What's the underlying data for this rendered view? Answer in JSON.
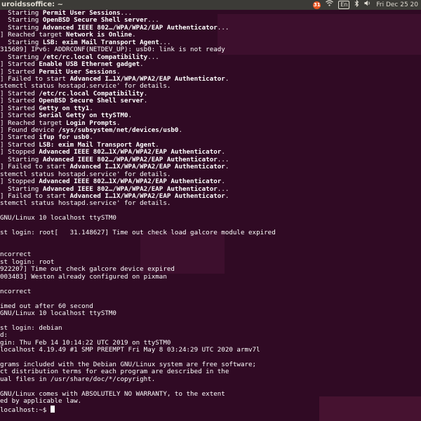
{
  "topbar": {
    "title": "uroidssoffice: ~",
    "clock": "Fri Dec 25 20",
    "lang": "En",
    "badge": "31",
    "icons": [
      "chrome-icon",
      "wifi-icon",
      "keyboard-language-icon",
      "bluetooth-icon",
      "volume-icon"
    ]
  },
  "terminal": {
    "lines": [
      [
        {
          "t": "  Starting "
        },
        {
          "t": "Permit User Sessions",
          "b": true
        },
        {
          "t": "..."
        }
      ],
      [
        {
          "t": "  Starting "
        },
        {
          "t": "OpenBSD Secure Shell server",
          "b": true
        },
        {
          "t": "..."
        }
      ],
      [
        {
          "t": "  Starting "
        },
        {
          "t": "Advanced IEEE 802…/WPA/WPA2/EAP Authenticator",
          "b": true
        },
        {
          "t": "..."
        }
      ],
      [
        {
          "t": "] Reached target "
        },
        {
          "t": "Network is Online",
          "b": true
        },
        {
          "t": "."
        }
      ],
      [
        {
          "t": "  Starting "
        },
        {
          "t": "LSB: exim Mail Transport Agent",
          "b": true
        },
        {
          "t": "..."
        }
      ],
      [
        {
          "t": "315689] IPv6: ADDRCONF(NETDEV_UP): usb0: link is not ready"
        }
      ],
      [
        {
          "t": "  Starting "
        },
        {
          "t": "/etc/rc.local Compatibility",
          "b": true
        },
        {
          "t": "..."
        }
      ],
      [
        {
          "t": "] Started "
        },
        {
          "t": "Enable USB Ethernet gadget",
          "b": true
        },
        {
          "t": "."
        }
      ],
      [
        {
          "t": "] Started "
        },
        {
          "t": "Permit User Sessions",
          "b": true
        },
        {
          "t": "."
        }
      ],
      [
        {
          "t": "] Failed to start "
        },
        {
          "t": "Advanced I…1X/WPA/WPA2/EAP Authenticator",
          "b": true
        },
        {
          "t": "."
        }
      ],
      [
        {
          "t": "stemctl status hostapd.service' for details."
        }
      ],
      [
        {
          "t": "] Started "
        },
        {
          "t": "/etc/rc.local Compatibility",
          "b": true
        },
        {
          "t": "."
        }
      ],
      [
        {
          "t": "] Started "
        },
        {
          "t": "OpenBSD Secure Shell server",
          "b": true
        },
        {
          "t": "."
        }
      ],
      [
        {
          "t": "] Started "
        },
        {
          "t": "Getty on tty1",
          "b": true
        },
        {
          "t": "."
        }
      ],
      [
        {
          "t": "] Started "
        },
        {
          "t": "Serial Getty on ttySTM0",
          "b": true
        },
        {
          "t": "."
        }
      ],
      [
        {
          "t": "] Reached target "
        },
        {
          "t": "Login Prompts",
          "b": true
        },
        {
          "t": "."
        }
      ],
      [
        {
          "t": "] Found device "
        },
        {
          "t": "/sys/subsystem/net/devices/usb0",
          "b": true
        },
        {
          "t": "."
        }
      ],
      [
        {
          "t": "] Started "
        },
        {
          "t": "ifup for usb0",
          "b": true
        },
        {
          "t": "."
        }
      ],
      [
        {
          "t": "] Started "
        },
        {
          "t": "LSB: exim Mail Transport Agent",
          "b": true
        },
        {
          "t": "."
        }
      ],
      [
        {
          "t": "] Stopped "
        },
        {
          "t": "Advanced IEEE 802…1X/WPA/WPA2/EAP Authenticator",
          "b": true
        },
        {
          "t": "."
        }
      ],
      [
        {
          "t": "  Starting "
        },
        {
          "t": "Advanced IEEE 802…/WPA/WPA2/EAP Authenticator",
          "b": true
        },
        {
          "t": "..."
        }
      ],
      [
        {
          "t": "] Failed to start "
        },
        {
          "t": "Advanced I…1X/WPA/WPA2/EAP Authenticator",
          "b": true
        },
        {
          "t": "."
        }
      ],
      [
        {
          "t": "stemctl status hostapd.service' for details."
        }
      ],
      [
        {
          "t": "] Stopped "
        },
        {
          "t": "Advanced IEEE 802…1X/WPA/WPA2/EAP Authenticator",
          "b": true
        },
        {
          "t": "."
        }
      ],
      [
        {
          "t": "  Starting "
        },
        {
          "t": "Advanced IEEE 802…/WPA/WPA2/EAP Authenticator",
          "b": true
        },
        {
          "t": "..."
        }
      ],
      [
        {
          "t": "] Failed to start "
        },
        {
          "t": "Advanced I…1X/WPA/WPA2/EAP Authenticator",
          "b": true
        },
        {
          "t": "."
        }
      ],
      [
        {
          "t": "stemctl status hostapd.service' for details."
        }
      ],
      [
        {
          "t": ""
        }
      ],
      [
        {
          "t": "GNU/Linux 10 localhost ttySTM0"
        }
      ],
      [
        {
          "t": ""
        }
      ],
      [
        {
          "t": "st login: root[   31.148627] Time out check load galcore module expired"
        }
      ],
      [
        {
          "t": ""
        }
      ],
      [
        {
          "t": ""
        }
      ],
      [
        {
          "t": "ncorrect"
        }
      ],
      [
        {
          "t": "st login: root"
        }
      ],
      [
        {
          "t": "922207] Time out check galcore device expired"
        }
      ],
      [
        {
          "t": "003483] Weston already configured on pixman"
        }
      ],
      [
        {
          "t": ""
        }
      ],
      [
        {
          "t": "ncorrect"
        }
      ],
      [
        {
          "t": ""
        }
      ],
      [
        {
          "t": "imed out after 60 second"
        }
      ],
      [
        {
          "t": "GNU/Linux 10 localhost ttySTM0"
        }
      ],
      [
        {
          "t": ""
        }
      ],
      [
        {
          "t": "st login: debian"
        }
      ],
      [
        {
          "t": "d:"
        }
      ],
      [
        {
          "t": "gin: Thu Feb 14 10:14:22 UTC 2019 on ttySTM0"
        }
      ],
      [
        {
          "t": "localhost 4.19.49 #1 SMP PREEMPT Fri May 8 03:24:29 UTC 2020 armv7l"
        }
      ],
      [
        {
          "t": ""
        }
      ],
      [
        {
          "t": "grams included with the Debian GNU/Linux system are free software;"
        }
      ],
      [
        {
          "t": "ct distribution terms for each program are described in the"
        }
      ],
      [
        {
          "t": "ual files in /usr/share/doc/*/copyright."
        }
      ],
      [
        {
          "t": ""
        }
      ],
      [
        {
          "t": "GNU/Linux comes with ABSOLUTELY NO WARRANTY, to the extent"
        }
      ],
      [
        {
          "t": "ed by applicable law."
        }
      ],
      [
        {
          "t": "localhost:~$ "
        }
      ]
    ]
  }
}
